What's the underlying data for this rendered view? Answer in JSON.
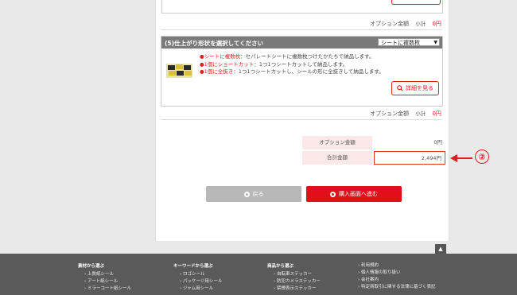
{
  "section_prev": {
    "option_label": "オプション金額",
    "subtotal_label": "小計",
    "subtotal_value": "0円"
  },
  "section5": {
    "title": "(5)仕上がり形状を選択してください",
    "select_value": "シートに複数枚",
    "desc": [
      {
        "bullet": "●",
        "emph": "シートに複数枚",
        "text": "：セパレートシートに複数枚つけたかたちで納品します。"
      },
      {
        "bullet": "●",
        "emph": "1個にショートカット",
        "text": "：1つ1つシートカットして納品します。"
      },
      {
        "bullet": "●",
        "emph": "1個に全抜き",
        "text": "：1つ1つシートカットし、シールの形に全抜きして納品します。"
      }
    ],
    "detail_button": "詳細を見る",
    "option_label": "オプション金額",
    "subtotal_label": "小計",
    "subtotal_value": "0円"
  },
  "totals": {
    "option_label": "オプション金額",
    "option_value": "0円",
    "total_label": "合計金額",
    "total_value": "2,494円"
  },
  "annotation": {
    "marker": "②"
  },
  "buttons": {
    "back": "戻る",
    "purchase": "購入画面へ進む"
  },
  "top_button": "▲",
  "footer": {
    "columns": [
      {
        "heading": "素材から選ぶ",
        "items": [
          "上質紙シール",
          "アート紙シール",
          "ミラーコート紙シール"
        ]
      },
      {
        "heading": "キーワードから選ぶ",
        "items": [
          "ロゴシール",
          "パッケージ用シール",
          "ジャム用シール"
        ]
      },
      {
        "heading": "商品から選ぶ",
        "items": [
          "自転車ステッカー",
          "防犯カメラステッカー",
          "禁煙表示ステッカー"
        ]
      },
      {
        "heading": "",
        "items": [
          "利用規約",
          "個人情報の取り扱い",
          "会社案内",
          "特定商取引に関する法律に基づく表記"
        ]
      }
    ]
  },
  "colors": {
    "accent": "#e00f1a",
    "header_gray": "#7a7a7a",
    "footer": "#5a5a5a"
  }
}
